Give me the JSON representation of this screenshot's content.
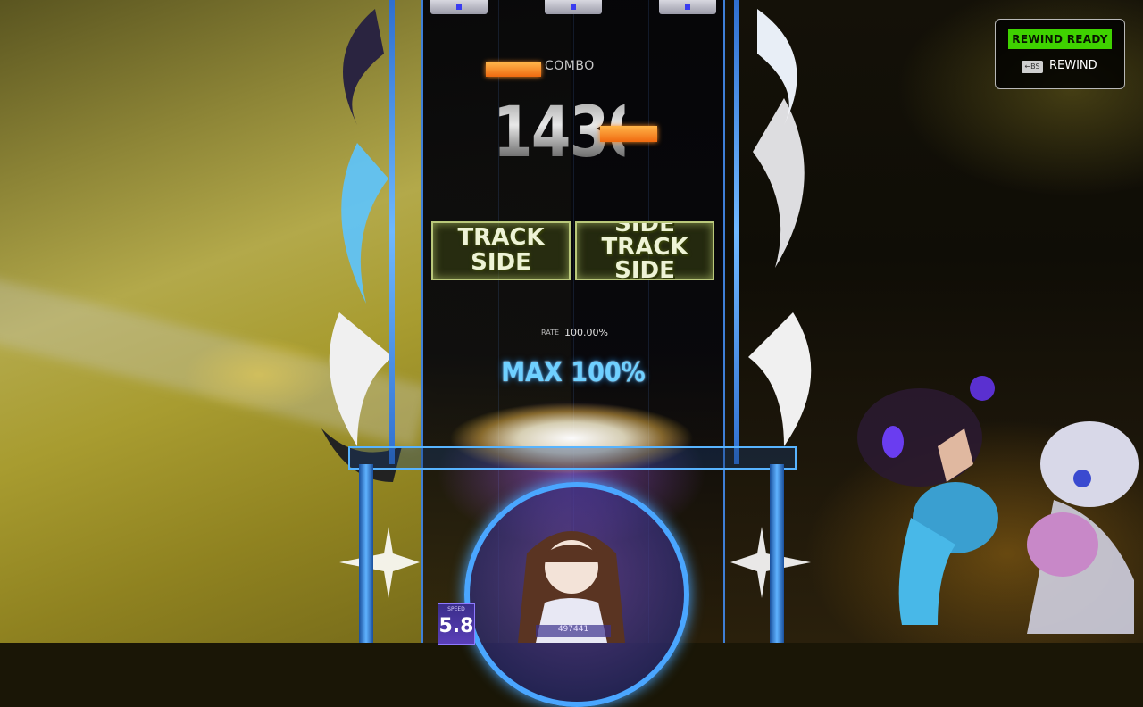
{
  "hud": {
    "combo_label": "COMBO",
    "combo_count": "1430",
    "judgement_left": "TRACK SIDE",
    "judgement_right": "SIDE TRACK SIDE",
    "rate_label": "RATE",
    "rate_value": "100.00%",
    "max_label": "MAX 100%",
    "speed_label": "SPEED",
    "speed_value": "5.8",
    "score_value": "497441"
  },
  "rewind": {
    "ready_label": "REWIND READY",
    "key_hint": "←BS",
    "action_label": "REWIND"
  },
  "colors": {
    "accent_green": "#3fd200",
    "lane_blue": "#3f7fd6",
    "combo_orange": "#f06a10",
    "max_blue": "#6fd0ff"
  }
}
